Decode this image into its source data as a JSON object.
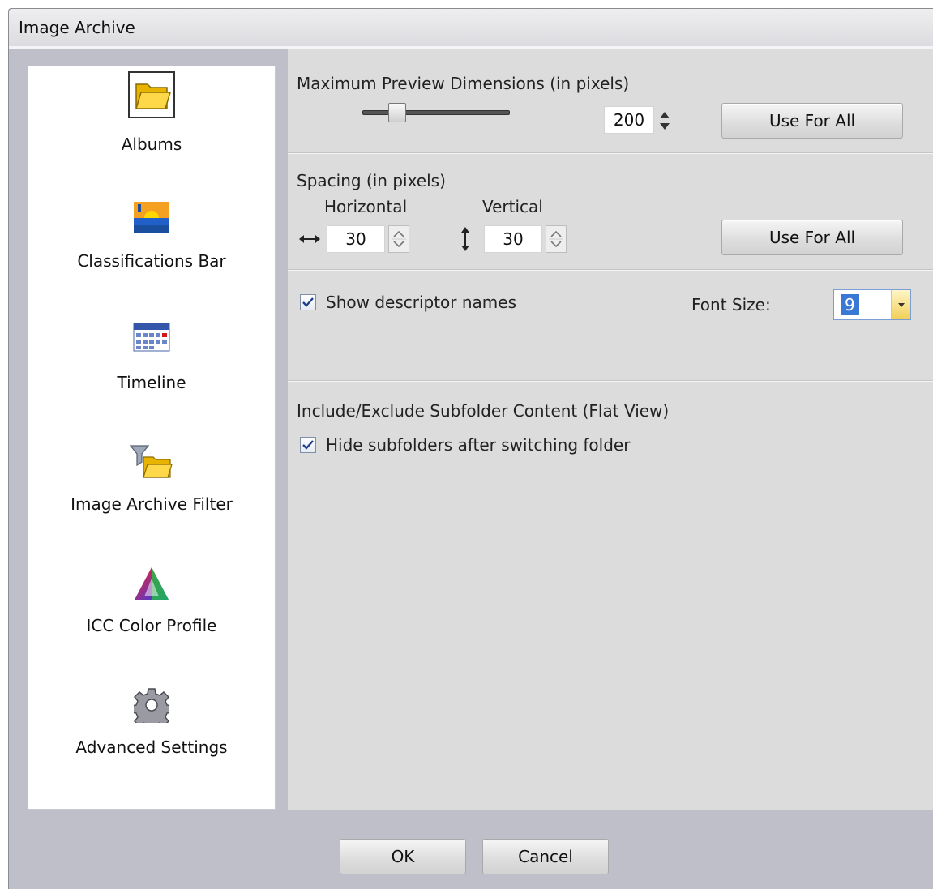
{
  "window": {
    "title": "Image Archive"
  },
  "sidebar": {
    "items": [
      {
        "label": "Albums",
        "icon": "folder-icon",
        "selected": true
      },
      {
        "label": "Classifications Bar",
        "icon": "landscape-icon"
      },
      {
        "label": "Timeline",
        "icon": "calendar-icon"
      },
      {
        "label": "Image Archive Filter",
        "icon": "filter-folder-icon"
      },
      {
        "label": "ICC Color Profile",
        "icon": "color-triangle-icon"
      },
      {
        "label": "Advanced Settings",
        "icon": "gear-icon"
      }
    ]
  },
  "preview": {
    "heading": "Maximum Preview Dimensions (in pixels)",
    "value": "200",
    "slider_fraction": 0.2,
    "use_for_all_label": "Use For All"
  },
  "spacing": {
    "heading": "Spacing (in pixels)",
    "horizontal_label": "Horizontal",
    "vertical_label": "Vertical",
    "horizontal_value": "30",
    "vertical_value": "30",
    "use_for_all_label": "Use For All"
  },
  "descriptor": {
    "show_names_label": "Show descriptor names",
    "show_names_checked": true,
    "font_size_label": "Font Size:",
    "font_size_value": "9"
  },
  "subfolders": {
    "heading": "Include/Exclude Subfolder Content (Flat View)",
    "hide_label": "Hide subfolders after switching folder",
    "hide_checked": true
  },
  "footer": {
    "ok_label": "OK",
    "cancel_label": "Cancel"
  },
  "colors": {
    "accent": "#3a78d6",
    "panel": "#dcdcdc",
    "frame": "#bfbfca"
  }
}
